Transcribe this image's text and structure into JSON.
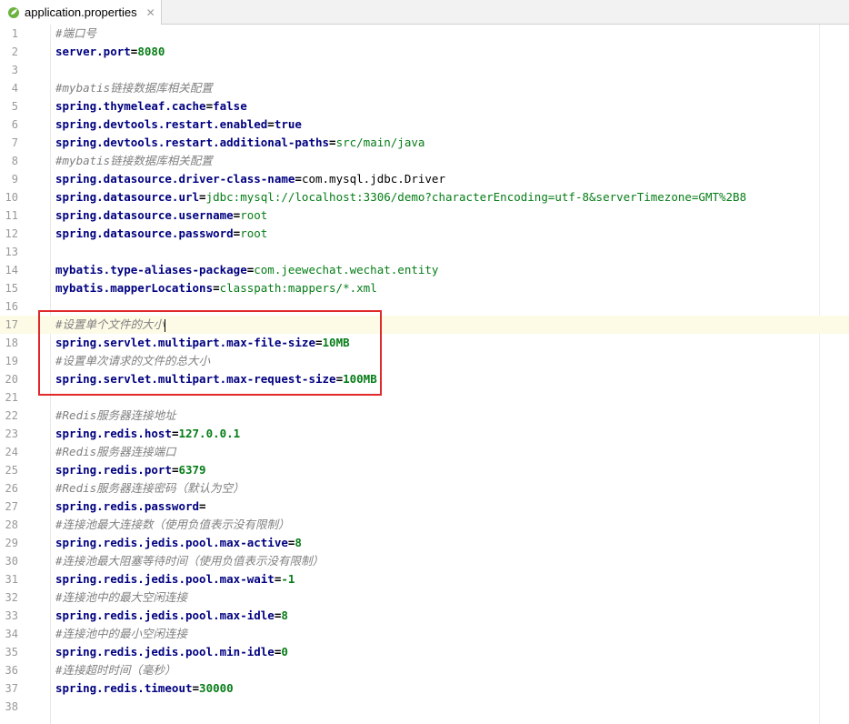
{
  "tab": {
    "title": "application.properties",
    "close_symbol": "✕",
    "icon": "spring-leaf-icon"
  },
  "lines": [
    {
      "n": "1",
      "type": "comment",
      "text": "#端口号"
    },
    {
      "n": "2",
      "type": "kv",
      "key": "server.port",
      "value": "8080",
      "style": "green"
    },
    {
      "n": "3",
      "type": "blank"
    },
    {
      "n": "4",
      "type": "comment",
      "text": "#mybatis链接数据库相关配置"
    },
    {
      "n": "5",
      "type": "kv",
      "key": "spring.thymeleaf.cache",
      "value": "false",
      "style": "key"
    },
    {
      "n": "6",
      "type": "kv",
      "key": "spring.devtools.restart.enabled",
      "value": "true",
      "style": "key"
    },
    {
      "n": "7",
      "type": "kv",
      "key": "spring.devtools.restart.additional-paths",
      "value": "src/main/java",
      "style": "greenplain"
    },
    {
      "n": "8",
      "type": "comment",
      "text": "#mybatis链接数据库相关配置"
    },
    {
      "n": "9",
      "type": "kv",
      "key": "spring.datasource.driver-class-name",
      "value": "com.mysql.jdbc.Driver",
      "style": "plain"
    },
    {
      "n": "10",
      "type": "kv",
      "key": "spring.datasource.url",
      "value": "jdbc:mysql://localhost:3306/demo?characterEncoding=utf-8&serverTimezone=GMT%2B8",
      "style": "greenplain"
    },
    {
      "n": "11",
      "type": "kv",
      "key": "spring.datasource.username",
      "value": "root",
      "style": "greenplain"
    },
    {
      "n": "12",
      "type": "kv",
      "key": "spring.datasource.password",
      "value": "root",
      "style": "greenplain"
    },
    {
      "n": "13",
      "type": "blank"
    },
    {
      "n": "14",
      "type": "kv",
      "key": "mybatis.type-aliases-package",
      "value": "com.jeewechat.wechat.entity",
      "style": "greenplain"
    },
    {
      "n": "15",
      "type": "kv",
      "key": "mybatis.mapperLocations",
      "value": "classpath:mappers/*.xml",
      "style": "greenplain"
    },
    {
      "n": "16",
      "type": "blank"
    },
    {
      "n": "17",
      "type": "comment",
      "text": "#设置单个文件的大小",
      "current": true
    },
    {
      "n": "18",
      "type": "kv",
      "key": "spring.servlet.multipart.max-file-size",
      "value": "10MB",
      "style": "green"
    },
    {
      "n": "19",
      "type": "comment",
      "text": "#设置单次请求的文件的总大小"
    },
    {
      "n": "20",
      "type": "kv",
      "key": "spring.servlet.multipart.max-request-size",
      "value": "100MB",
      "style": "green"
    },
    {
      "n": "21",
      "type": "blank"
    },
    {
      "n": "22",
      "type": "comment",
      "text": "#Redis服务器连接地址"
    },
    {
      "n": "23",
      "type": "kv",
      "key": "spring.redis.host",
      "value": "127.0.0.1",
      "style": "green"
    },
    {
      "n": "24",
      "type": "comment",
      "text": "#Redis服务器连接端口"
    },
    {
      "n": "25",
      "type": "kv",
      "key": "spring.redis.port",
      "value": "6379",
      "style": "green"
    },
    {
      "n": "26",
      "type": "comment",
      "text": "#Redis服务器连接密码（默认为空）"
    },
    {
      "n": "27",
      "type": "kv",
      "key": "spring.redis.password",
      "value": "",
      "style": "green"
    },
    {
      "n": "28",
      "type": "comment",
      "text": "#连接池最大连接数（使用负值表示没有限制）"
    },
    {
      "n": "29",
      "type": "kv",
      "key": "spring.redis.jedis.pool.max-active",
      "value": "8",
      "style": "green"
    },
    {
      "n": "30",
      "type": "comment",
      "text": "#连接池最大阻塞等待时间（使用负值表示没有限制）"
    },
    {
      "n": "31",
      "type": "kv",
      "key": "spring.redis.jedis.pool.max-wait",
      "value": "-1",
      "style": "green"
    },
    {
      "n": "32",
      "type": "comment",
      "text": "#连接池中的最大空闲连接"
    },
    {
      "n": "33",
      "type": "kv",
      "key": "spring.redis.jedis.pool.max-idle",
      "value": "8",
      "style": "green"
    },
    {
      "n": "34",
      "type": "comment",
      "text": "#连接池中的最小空闲连接"
    },
    {
      "n": "35",
      "type": "kv",
      "key": "spring.redis.jedis.pool.min-idle",
      "value": "0",
      "style": "green"
    },
    {
      "n": "36",
      "type": "comment",
      "text": "#连接超时时间（毫秒）"
    },
    {
      "n": "37",
      "type": "kv",
      "key": "spring.redis.timeout",
      "value": "30000",
      "style": "green"
    },
    {
      "n": "38",
      "type": "blank"
    }
  ],
  "colors": {
    "highlight_box": "#e0292b",
    "current_line": "#fdfbe6",
    "key": "#000080",
    "value": "#067d17",
    "comment": "#808080"
  }
}
